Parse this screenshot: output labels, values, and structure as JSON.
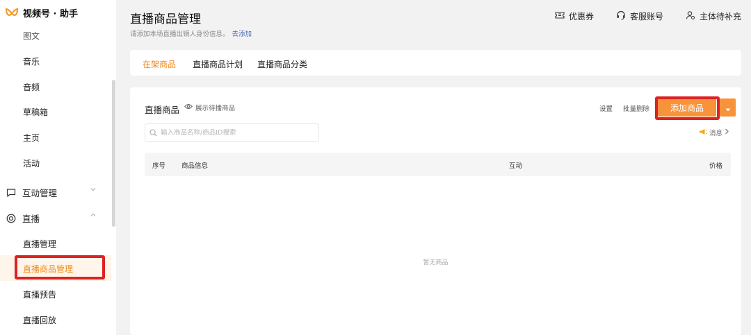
{
  "app": {
    "title": "视频号 · 助手"
  },
  "sidebar": {
    "items_top": [
      {
        "label": "图文"
      },
      {
        "label": "音乐"
      },
      {
        "label": "音频"
      },
      {
        "label": "草稿箱"
      },
      {
        "label": "主页"
      },
      {
        "label": "活动"
      }
    ],
    "groups": [
      {
        "label": "互动管理",
        "icon": "chat-bubble-icon",
        "expanded": false
      },
      {
        "label": "直播",
        "icon": "live-circle-icon",
        "expanded": true
      }
    ],
    "live_items": [
      {
        "label": "直播管理"
      },
      {
        "label": "直播商品管理",
        "active": true
      },
      {
        "label": "直播预告"
      },
      {
        "label": "直播回放"
      }
    ]
  },
  "header": {
    "title": "直播商品管理",
    "subtitle": "请添加本场直播出镜人身份信息。",
    "subtitle_link": "去添加",
    "actions": [
      {
        "label": "优惠券",
        "icon": "coupon-icon"
      },
      {
        "label": "客服账号",
        "icon": "headset-icon"
      },
      {
        "label": "主体待补充",
        "icon": "user-settings-icon"
      }
    ]
  },
  "tabs": [
    {
      "label": "在架商品",
      "active": true
    },
    {
      "label": "直播商品计划",
      "active": false
    },
    {
      "label": "直播商品分类",
      "active": false
    }
  ],
  "main": {
    "section_title": "直播商品",
    "show_pending": "展示待播商品",
    "settings": "设置",
    "batch_delete": "批量删除",
    "add_button": "添加商品",
    "search_placeholder": "输入商品名称/商品ID搜索",
    "message_link": "消息",
    "table_columns": [
      "序号",
      "商品信息",
      "互动",
      "价格"
    ],
    "empty_text": "暂无商品"
  },
  "colors": {
    "accent": "#f28b1c",
    "button": "#f8933b",
    "highlight_box": "#dd2222",
    "link": "#4a6fb3"
  }
}
